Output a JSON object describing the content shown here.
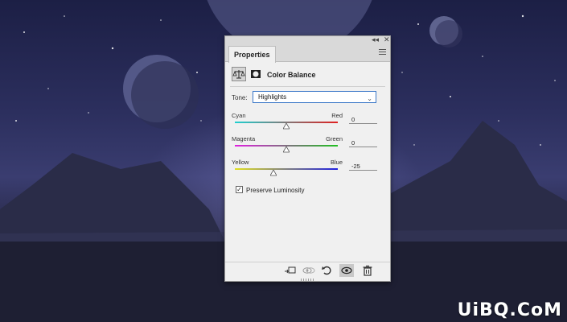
{
  "panel": {
    "tab_label": "Properties",
    "collapse_glyph": "◂◂",
    "close_glyph": "✕",
    "adjustment_title": "Color Balance"
  },
  "tone": {
    "label": "Tone:",
    "selected": "Highlights"
  },
  "sliders": [
    {
      "left": "Cyan",
      "right": "Red",
      "value": "0",
      "level": 0,
      "min": -100,
      "max": 100,
      "colors": [
        "#20d0d0",
        "#e02020"
      ]
    },
    {
      "left": "Magenta",
      "right": "Green",
      "value": "0",
      "level": 0,
      "min": -100,
      "max": 100,
      "colors": [
        "#e020e0",
        "#20c020"
      ]
    },
    {
      "left": "Yellow",
      "right": "Blue",
      "value": "-25",
      "level": -25,
      "min": -100,
      "max": 100,
      "colors": [
        "#e0e020",
        "#2020e0"
      ]
    }
  ],
  "preserve": {
    "label": "Preserve Luminosity",
    "checked": true
  },
  "toolbar_icons": [
    "clip-to-layer-icon",
    "view-previous-icon",
    "reset-icon",
    "visibility-icon",
    "delete-icon"
  ],
  "watermark": "UiBQ.CoM"
}
